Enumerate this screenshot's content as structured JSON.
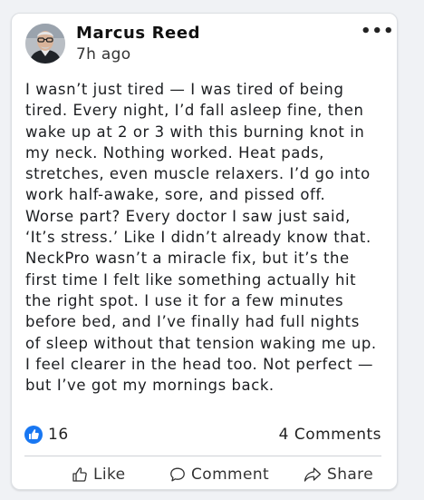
{
  "post": {
    "author_name": "Marcus Reed",
    "time": "7h ago",
    "more_label": "•••",
    "text_lines": [
      "I wasn’t just tired — I was tired of being",
      "tired. Every night, I’d fall asleep fine, then",
      "wake up at 2 or 3 with this burning knot in",
      "my neck. Nothing worked. Heat pads,",
      "stretches, even muscle relaxers. I’d go into",
      "work half-awake, sore, and pissed off.",
      "Worse part? Every doctor I saw just said,",
      "‘It’s stress.’ Like I didn’t already know that.",
      "NeckPro wasn’t a miracle fix, but it’s the",
      "first time I felt like something actually hit",
      "the right spot. I use it for a few minutes",
      "before bed, and I’ve finally had full nights",
      "of sleep without that tension waking me up.",
      "I feel clearer in the head too. Not perfect —",
      "but I’ve got my mornings back."
    ]
  },
  "stats": {
    "likes": "16",
    "comments": "4 Comments"
  },
  "actions": {
    "like": "Like",
    "comment": "Comment",
    "share": "Share"
  },
  "icons": {
    "avatar": "avatar-photo",
    "like_badge": "thumbs-up-icon",
    "like": "thumbs-up-outline-icon",
    "comment": "speech-bubble-icon",
    "share": "share-arrow-icon",
    "more": "more-options-icon"
  },
  "colors": {
    "accent": "#1877f2",
    "card_bg": "#ffffff",
    "page_bg": "#f0f2f5"
  }
}
